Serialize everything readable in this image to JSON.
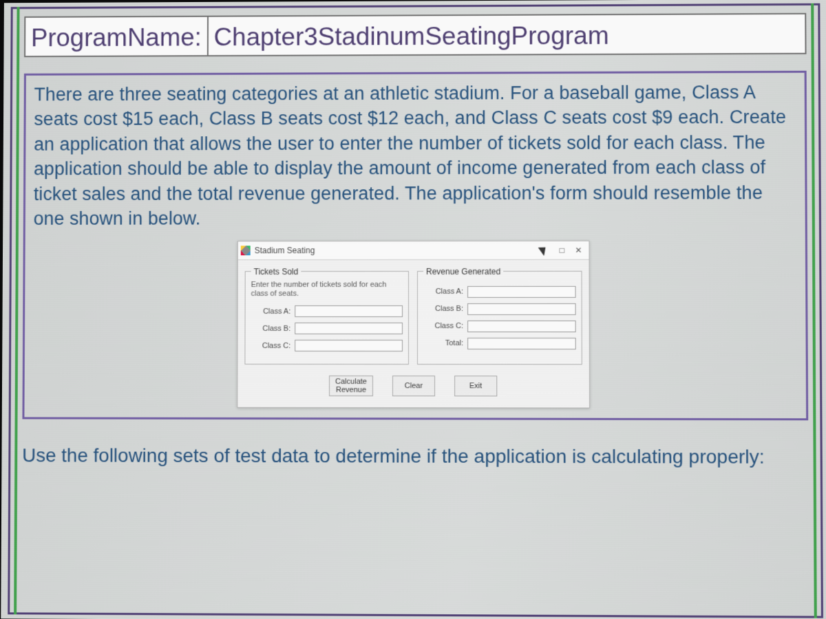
{
  "program_row": {
    "label": "ProgramName:",
    "value": "Chapter3StadinumSeatingProgram"
  },
  "description": "There are three seating categories at an athletic stadium. For a baseball game, Class A seats cost $15 each, Class B seats cost $12 each, and Class C seats cost $9 each. Create an application that allows the user to enter the number of tickets sold for each class. The application should be able to display the amount of income generated from each class of ticket sales and the total revenue generated. The application's form should resemble the one shown in below.",
  "mockform": {
    "title": "Stadium Seating",
    "controls": {
      "minimize": "–",
      "maximize": "□",
      "close": "✕"
    },
    "tickets": {
      "legend": "Tickets Sold",
      "hint": "Enter the number of tickets sold for each class of seats.",
      "rows": {
        "a": {
          "label": "Class A:",
          "value": ""
        },
        "b": {
          "label": "Class B:",
          "value": ""
        },
        "c": {
          "label": "Class C:",
          "value": ""
        }
      }
    },
    "revenue": {
      "legend": "Revenue Generated",
      "rows": {
        "a": {
          "label": "Class A:",
          "value": ""
        },
        "b": {
          "label": "Class B:",
          "value": ""
        },
        "c": {
          "label": "Class C:",
          "value": ""
        },
        "total": {
          "label": "Total:",
          "value": ""
        }
      }
    },
    "buttons": {
      "calculate": "Calculate\nRevenue",
      "clear": "Clear",
      "exit": "Exit"
    }
  },
  "footer": "Use the following sets of test data to determine if the application is calculating properly:"
}
